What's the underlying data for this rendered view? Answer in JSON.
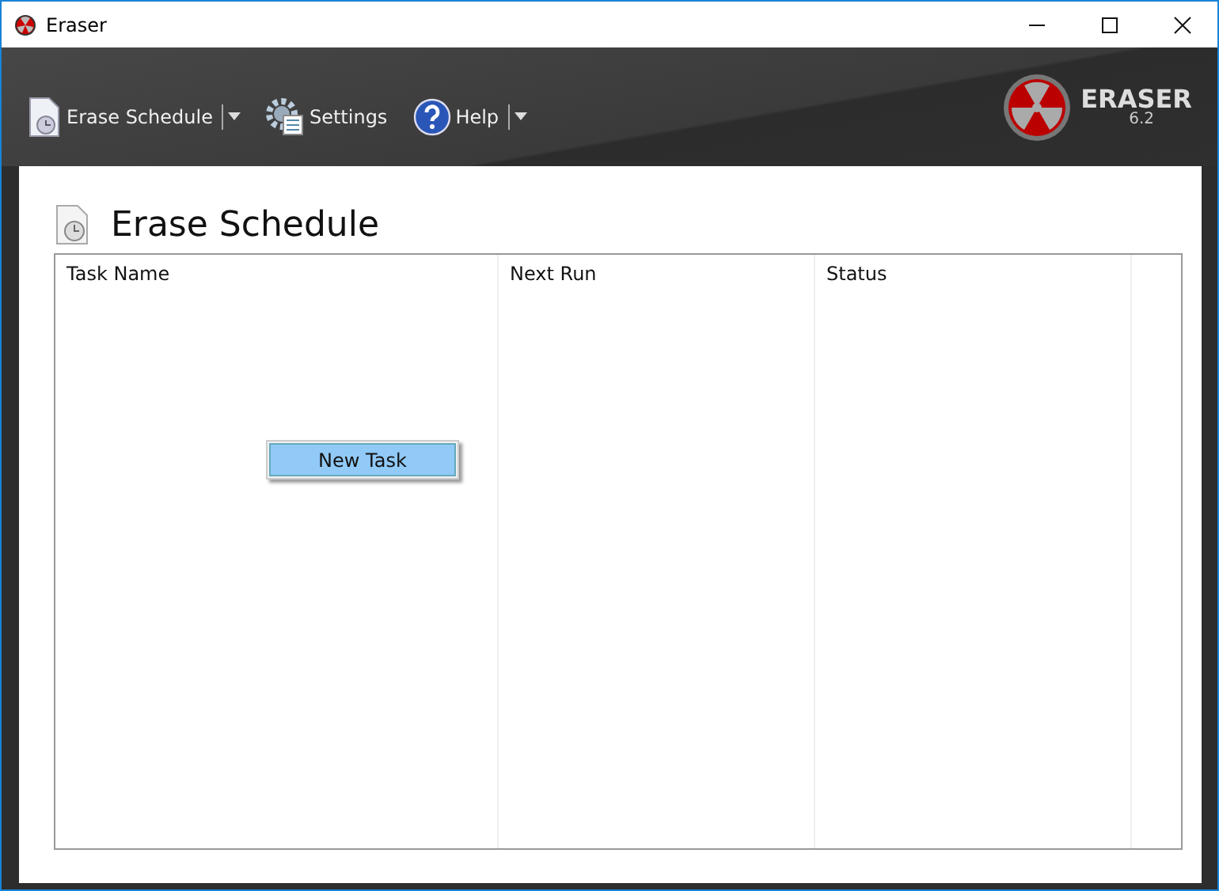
{
  "window": {
    "title": "Eraser"
  },
  "toolbar": {
    "items": [
      {
        "label": "Erase Schedule",
        "kind": "schedule",
        "has_dropdown": true
      },
      {
        "label": "Settings",
        "kind": "settings",
        "has_dropdown": false
      },
      {
        "label": "Help",
        "kind": "help",
        "has_dropdown": true
      }
    ]
  },
  "logo": {
    "name": "ERASER",
    "version": "6.2"
  },
  "page": {
    "title": "Erase Schedule"
  },
  "table": {
    "columns": [
      "Task Name",
      "Next Run",
      "Status"
    ]
  },
  "context_menu": {
    "items": [
      {
        "label": "New Task",
        "selected": true
      }
    ]
  }
}
